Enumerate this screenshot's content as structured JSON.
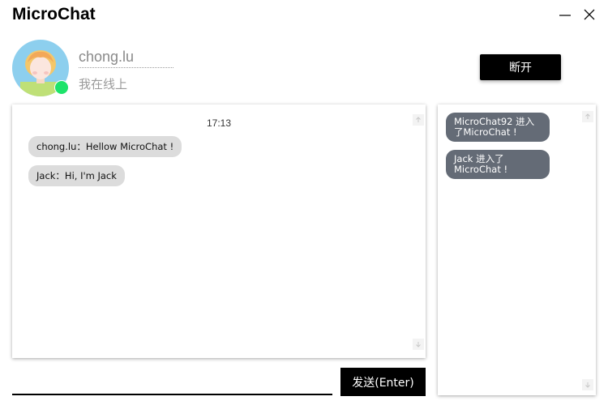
{
  "app": {
    "title": "MicroChat"
  },
  "window_controls": {
    "minimize_icon": "minimize-icon",
    "close_icon": "close-icon"
  },
  "profile": {
    "username": "chong.lu",
    "status": "我在线上",
    "online": true,
    "status_color": "#1de36a"
  },
  "header": {
    "disconnect_label": "断开"
  },
  "chat": {
    "timestamp": "17:13",
    "messages": [
      {
        "text": "chong.lu：Hellow MicroChat !"
      },
      {
        "text": "Jack：Hi, I'm Jack"
      }
    ]
  },
  "notices": {
    "items": [
      {
        "text": "MicroChat92 进入了MicroChat !"
      },
      {
        "text": "Jack 进入了MicroChat !"
      }
    ]
  },
  "composer": {
    "value": "",
    "send_label": "发送(Enter)"
  },
  "colors": {
    "bubble": "#dcdcdc",
    "notice_bubble": "#646b76",
    "button": "#000000"
  }
}
